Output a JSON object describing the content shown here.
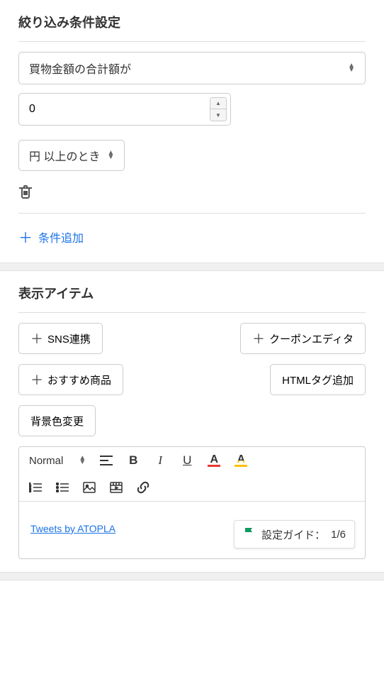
{
  "filter": {
    "title": "絞り込み条件設定",
    "totalAmountLabel": "買物金額の合計額が",
    "amountValue": "0",
    "currencyCondition": "円 以上のとき",
    "addConditionLabel": "条件追加"
  },
  "display": {
    "title": "表示アイテム",
    "buttons": {
      "sns": "SNS連携",
      "coupon": "クーポンエディタ",
      "recommend": "おすすめ商品",
      "htmlTag": "HTMLタグ追加",
      "bgColor": "背景色変更"
    },
    "toolbar": {
      "normal": "Normal"
    },
    "tweetLink": "Tweets by ATOPLA",
    "guide": {
      "label": "設定ガイド：",
      "progress": "1/6"
    }
  }
}
